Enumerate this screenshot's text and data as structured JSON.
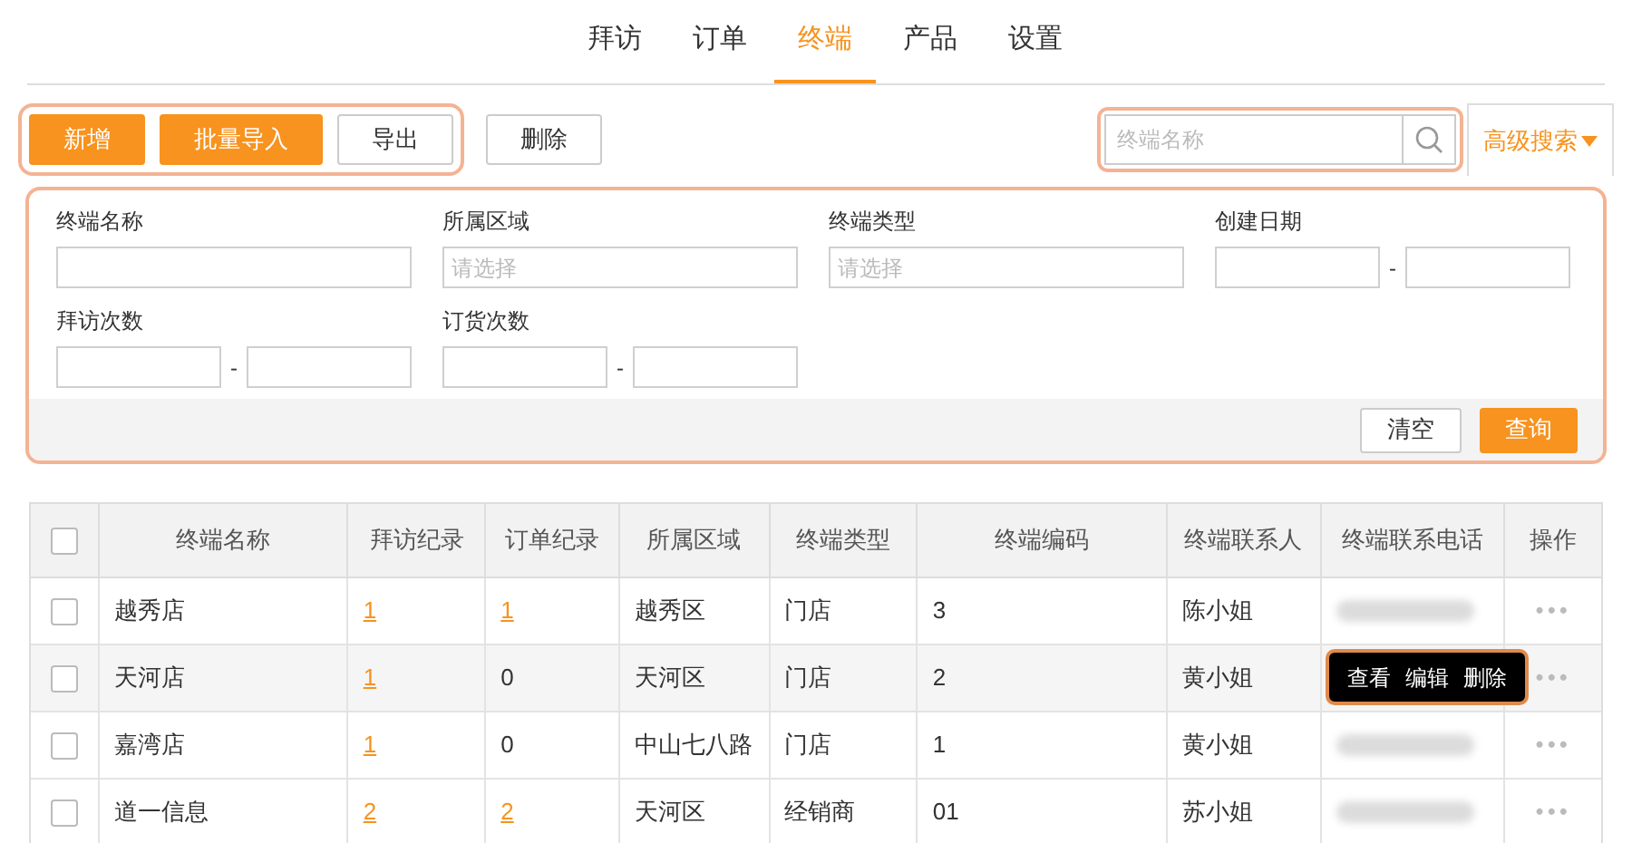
{
  "tabs": [
    {
      "label": "拜访",
      "selected": false
    },
    {
      "label": "订单",
      "selected": false
    },
    {
      "label": "终端",
      "selected": true
    },
    {
      "label": "产品",
      "selected": false
    },
    {
      "label": "设置",
      "selected": false
    }
  ],
  "toolbar": {
    "buttons": [
      {
        "label": "新增",
        "kind": "primary"
      },
      {
        "label": "批量导入",
        "kind": "primary"
      },
      {
        "label": "导出",
        "kind": "plain"
      }
    ],
    "delete": "删除"
  },
  "search": {
    "placeholder": "终端名称",
    "advanced": "高级搜索",
    "expanded": true
  },
  "filters": {
    "rows": [
      [
        {
          "label": "终端名称",
          "kind": "text"
        },
        {
          "label": "所属区域",
          "kind": "select",
          "placeholder": "请选择"
        },
        {
          "label": "终端类型",
          "kind": "select",
          "placeholder": "请选择"
        },
        {
          "label": "创建日期",
          "kind": "range",
          "separator": "-"
        }
      ],
      [
        {
          "label": "拜访次数",
          "kind": "range",
          "separator": "-"
        },
        {
          "label": "订货次数",
          "kind": "range",
          "separator": "-"
        }
      ]
    ],
    "clear": "清空",
    "query": "查询"
  },
  "table": {
    "select_all_checked": false,
    "columns": [
      "终端名称",
      "拜访纪录",
      "订单纪录",
      "所属区域",
      "终端类型",
      "终端编码",
      "终端联系人",
      "终端联系电话",
      "操作"
    ],
    "rows": [
      {
        "checked": false,
        "hovered": false,
        "name": "越秀店",
        "visits": "1",
        "visits_link": true,
        "orders": "1",
        "orders_link": true,
        "region": "越秀区",
        "type": "门店",
        "code": "3",
        "contact": "陈小姐",
        "more": "•••"
      },
      {
        "checked": false,
        "hovered": true,
        "name": "天河店",
        "visits": "1",
        "visits_link": true,
        "orders": "0",
        "orders_link": false,
        "region": "天河区",
        "type": "门店",
        "code": "2",
        "contact": "黄小姐",
        "more": "•••"
      },
      {
        "checked": false,
        "hovered": false,
        "name": "嘉湾店",
        "visits": "1",
        "visits_link": true,
        "orders": "0",
        "orders_link": false,
        "region": "中山七八路",
        "type": "门店",
        "code": "1",
        "contact": "黄小姐",
        "more": "•••"
      },
      {
        "checked": false,
        "hovered": false,
        "name": "道一信息",
        "visits": "2",
        "visits_link": true,
        "orders": "2",
        "orders_link": true,
        "region": "天河区",
        "type": "经销商",
        "code": "01",
        "contact": "苏小姐",
        "more": "•••"
      }
    ]
  },
  "row_menu": [
    "查看",
    "编辑",
    "删除"
  ]
}
